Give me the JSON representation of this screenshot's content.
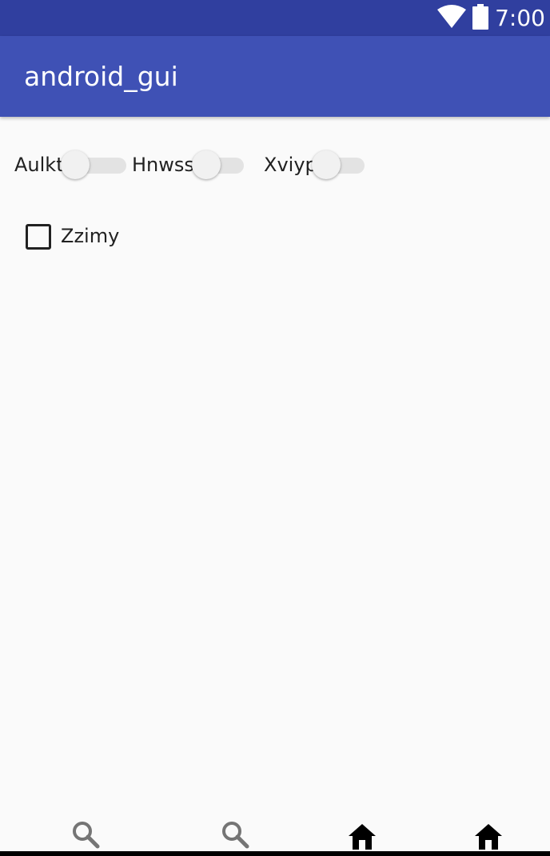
{
  "status_bar": {
    "time": "7:00",
    "icons": [
      "wifi-icon",
      "battery-icon"
    ],
    "color": "#303f9f"
  },
  "app_bar": {
    "title": "android_gui",
    "color": "#3f51b5"
  },
  "switches": [
    {
      "label": "Aulkt",
      "checked": false
    },
    {
      "label": "Hnwss",
      "checked": false
    },
    {
      "label": "Xviyp",
      "checked": false
    }
  ],
  "checkbox": {
    "label": "Zzimy",
    "checked": false
  },
  "bottom_nav": {
    "items": [
      {
        "icon": "search-icon",
        "color": "#757575"
      },
      {
        "icon": "search-icon",
        "color": "#757575"
      },
      {
        "icon": "home-icon",
        "color": "#000000"
      },
      {
        "icon": "home-icon",
        "color": "#000000"
      }
    ]
  }
}
